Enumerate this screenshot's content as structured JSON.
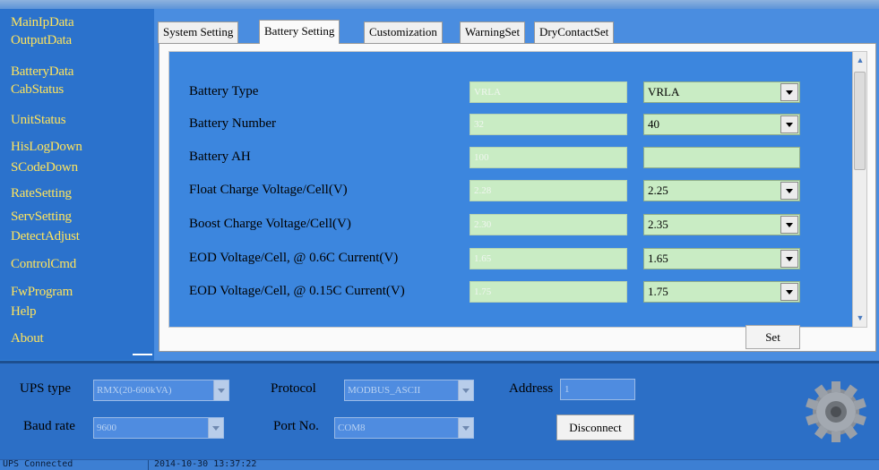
{
  "sidebar": {
    "items": [
      "MainIpData",
      "OutputData",
      "BatteryData",
      "CabStatus",
      "UnitStatus",
      "HisLogDown",
      "SCodeDown",
      "RateSetting",
      "ServSetting",
      "DetectAdjust",
      "ControlCmd",
      "FwProgram",
      "Help",
      "About"
    ]
  },
  "tabs": [
    "System Setting",
    "Battery Setting",
    "Customization",
    "WarningSet",
    "DryContactSet"
  ],
  "battery_setting": {
    "rows": [
      {
        "label": "Battery Type",
        "current": "VRLA",
        "selected": "VRLA",
        "has_dropdown": true
      },
      {
        "label": "Battery Number",
        "current": "32",
        "selected": "40",
        "has_dropdown": true
      },
      {
        "label": "Battery AH",
        "current": "100",
        "selected": "",
        "has_dropdown": false
      },
      {
        "label": "Float Charge Voltage/Cell(V)",
        "current": "2.28",
        "selected": "2.25",
        "has_dropdown": true
      },
      {
        "label": "Boost Charge Voltage/Cell(V)",
        "current": "2.30",
        "selected": "2.35",
        "has_dropdown": true
      },
      {
        "label": "EOD Voltage/Cell, @ 0.6C Current(V)",
        "current": "1.65",
        "selected": "1.65",
        "has_dropdown": true
      },
      {
        "label": "EOD Voltage/Cell, @ 0.15C Current(V)",
        "current": "1.75",
        "selected": "1.75",
        "has_dropdown": true
      }
    ],
    "set_label": "Set"
  },
  "connection": {
    "ups_type_label": "UPS type",
    "ups_type_value": "RMX(20-600kVA)",
    "protocol_label": "Protocol",
    "protocol_value": "MODBUS_ASCII",
    "address_label": "Address",
    "address_value": "1",
    "baud_rate_label": "Baud rate",
    "baud_rate_value": "9600",
    "port_label": "Port No.",
    "port_value": "COM8",
    "disconnect_label": "Disconnect"
  },
  "status": {
    "connection": "UPS Connected",
    "datetime": "2014-10-30 13:37:22"
  }
}
